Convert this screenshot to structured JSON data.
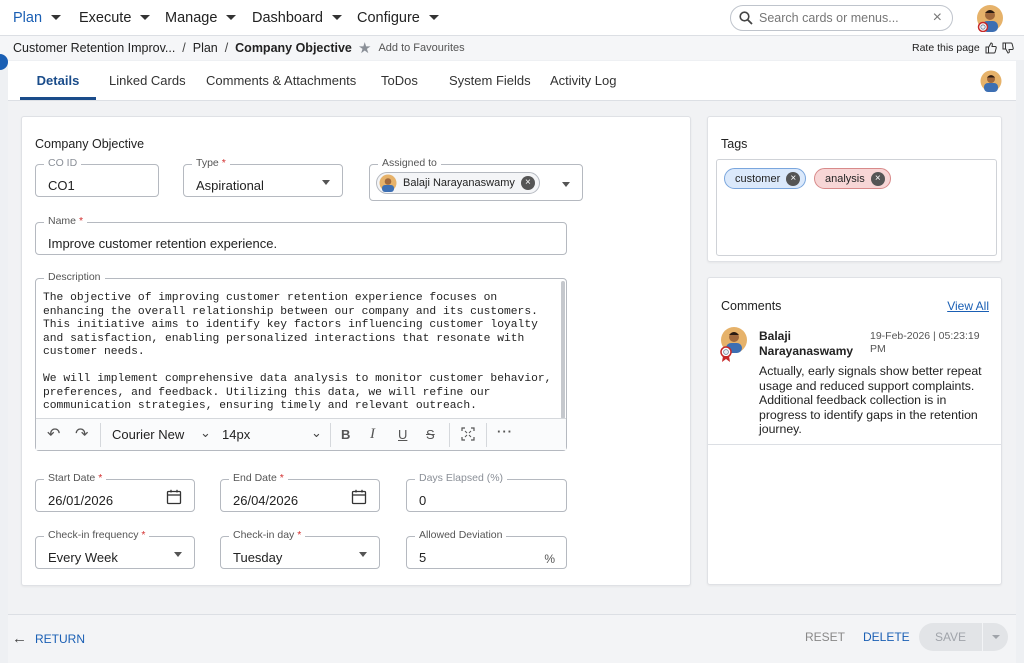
{
  "nav": {
    "items": [
      "Plan",
      "Execute",
      "Manage",
      "Dashboard",
      "Configure"
    ],
    "search_placeholder": "Search cards or menus...",
    "active_color": "#1a5fb4"
  },
  "breadcrumb": {
    "parent": "Customer Retention Improv...",
    "section": "Plan",
    "current": "Company Objective",
    "favourite": "Add to Favourites",
    "rate": "Rate this page"
  },
  "tabs": [
    "Details",
    "Linked Cards",
    "Comments & Attachments",
    "ToDos",
    "System Fields",
    "Activity Log"
  ],
  "form": {
    "title": "Company Objective",
    "co_id": {
      "label": "CO ID",
      "value": "CO1"
    },
    "type": {
      "label": "Type",
      "value": "Aspirational"
    },
    "assigned": {
      "label": "Assigned to",
      "value": "Balaji Narayanaswamy"
    },
    "name": {
      "label": "Name",
      "value": "Improve customer retention experience."
    },
    "description": {
      "label": "Description",
      "paragraphs": [
        "The objective of improving customer retention experience focuses on enhancing the overall relationship between our company and its customers. This initiative aims to identify key factors influencing customer loyalty and satisfaction, enabling personalized interactions that resonate with customer needs.",
        "We will implement comprehensive data analysis to monitor customer behavior, preferences, and feedback. Utilizing this data, we will refine our communication strategies, ensuring timely and relevant outreach."
      ]
    },
    "toolbar": {
      "font": "Courier New",
      "size": "14px"
    },
    "start_date": {
      "label": "Start Date",
      "value": "26/01/2026"
    },
    "end_date": {
      "label": "End Date",
      "value": "26/04/2026"
    },
    "days_elapsed": {
      "label": "Days Elapsed (%)",
      "value": "0"
    },
    "checkin_frequency": {
      "label": "Check-in frequency",
      "value": "Every Week"
    },
    "checkin_day": {
      "label": "Check-in day",
      "value": "Tuesday"
    },
    "allowed_deviation": {
      "label": "Allowed Deviation",
      "value": "5",
      "unit": "%"
    }
  },
  "tags": {
    "title": "Tags",
    "items": [
      {
        "label": "customer",
        "color": "#dbe9fb",
        "border": "#7aa6dd"
      },
      {
        "label": "analysis",
        "color": "#f7d6d6",
        "border": "#d88a8a"
      }
    ]
  },
  "comments": {
    "title": "Comments",
    "view_all": "View All",
    "items": [
      {
        "author": "Balaji Narayanaswamy",
        "time": "19-Feb-2026 | 05:23:19 PM",
        "text": "Actually, early signals show better repeat usage and reduced support complaints. Additional feedback collection is in progress to identify gaps in the retention journey."
      }
    ]
  },
  "footer": {
    "return": "RETURN",
    "reset": "RESET",
    "delete": "DELETE",
    "save": "SAVE"
  }
}
